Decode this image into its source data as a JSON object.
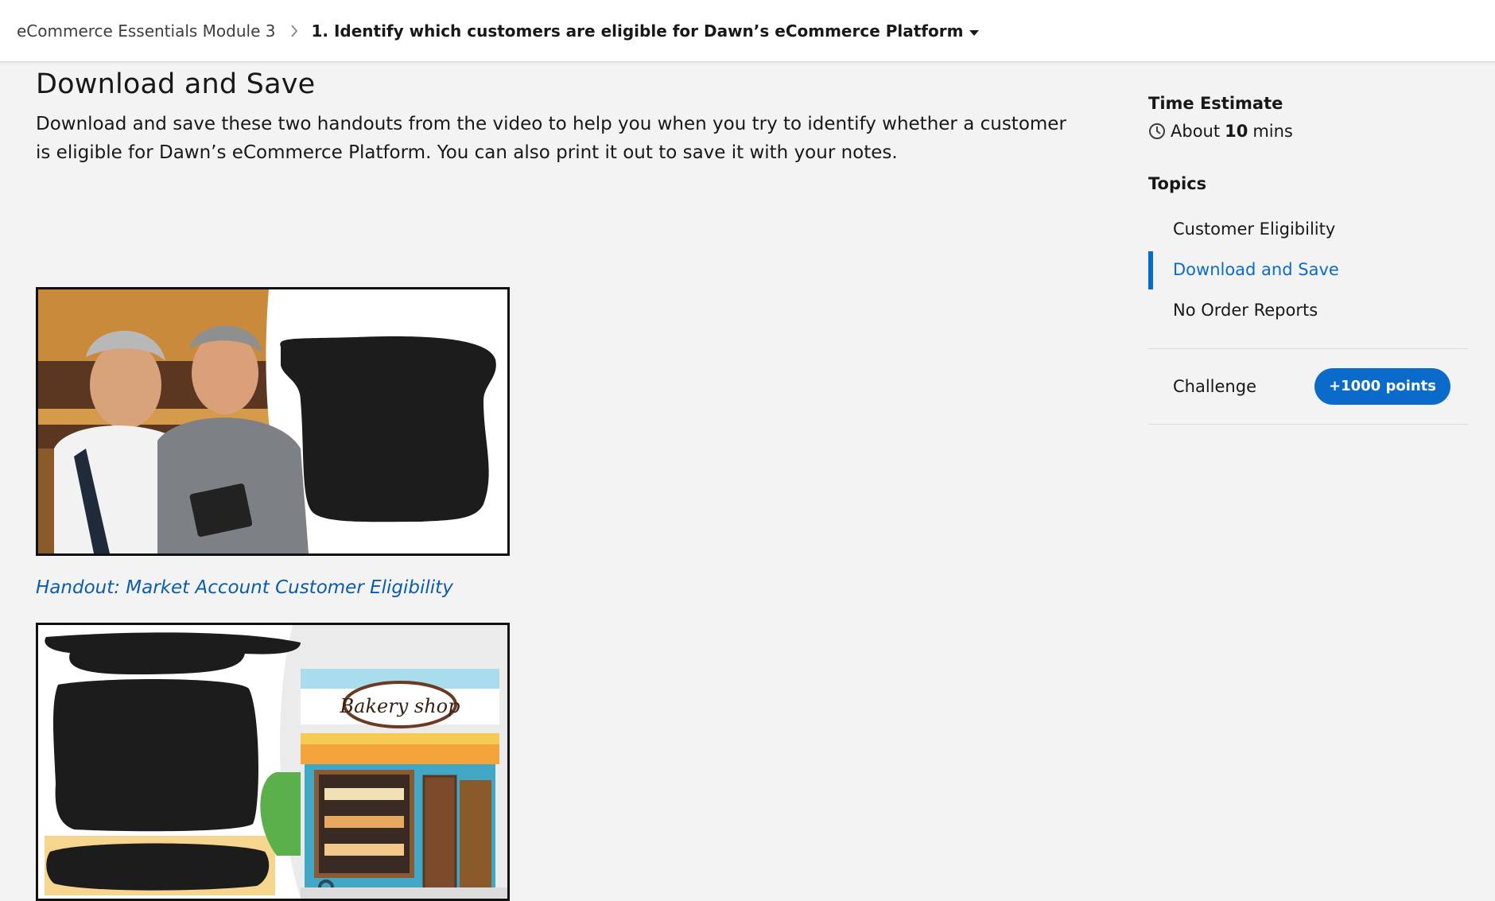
{
  "breadcrumb": {
    "module": "eCommerce Essentials Module 3",
    "current": "1. Identify which customers are eligible for Dawn’s eCommerce Platform"
  },
  "main": {
    "title": "Download and Save",
    "intro": "Download and save these two handouts from the video to help you when you try to identify whether a customer is eligible for Dawn’s eCommerce Platform.  You can also print it out to save it with your notes.",
    "handout_link": "Handout: Market Account Customer Eligibility",
    "bakery_sign": "Bakery shop"
  },
  "sidebar": {
    "time_heading": "Time Estimate",
    "time_prefix": "About",
    "time_value": "10",
    "time_unit": "mins",
    "topics_heading": "Topics",
    "topics": [
      {
        "label": "Customer Eligibility",
        "active": false
      },
      {
        "label": "Download and Save",
        "active": true
      },
      {
        "label": "No Order Reports",
        "active": false
      }
    ],
    "challenge_label": "Challenge",
    "challenge_points": "+1000 points"
  },
  "colors": {
    "accent": "#0b6bcb",
    "link": "#0b5cab",
    "background": "#f3f3f3"
  }
}
